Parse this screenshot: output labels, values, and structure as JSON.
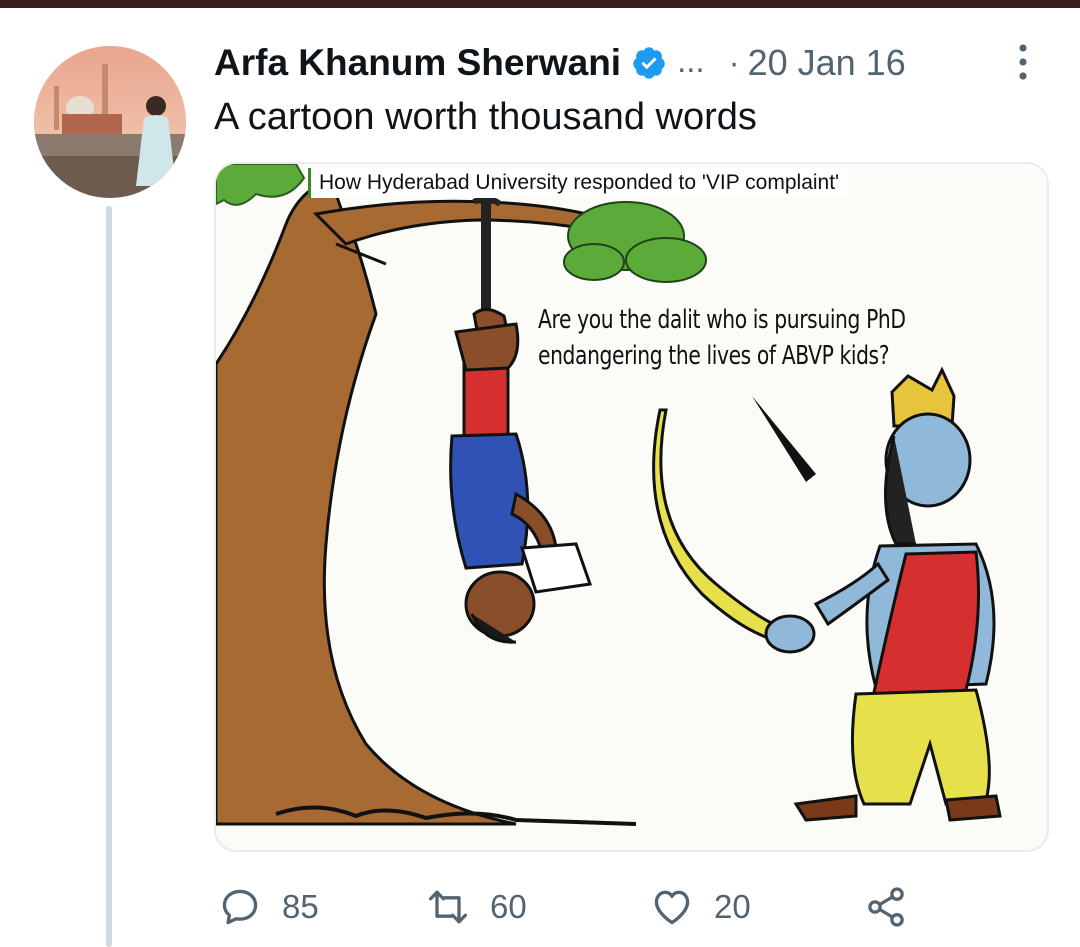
{
  "tweet": {
    "author_name": "Arfa Khanum Sherwani",
    "handle_ellipsis": "...",
    "separator": "·",
    "date": "20 Jan 16",
    "text": "A cartoon worth thousand words",
    "verified": true
  },
  "media": {
    "caption": "How Hyderabad University responded to 'VIP complaint'",
    "speech_line1": "Are you the dalit who is pursuing PhD",
    "speech_line2": "endangering the lives of ABVP kids?"
  },
  "actions": {
    "replies": "85",
    "retweets": "60",
    "likes": "20"
  },
  "colors": {
    "verified_blue": "#1d9bf0",
    "muted_text": "#536471",
    "thread_line": "#cfd9de"
  },
  "icons": [
    "verified-badge-icon",
    "more-options-icon",
    "reply-icon",
    "retweet-icon",
    "like-icon",
    "share-icon"
  ]
}
